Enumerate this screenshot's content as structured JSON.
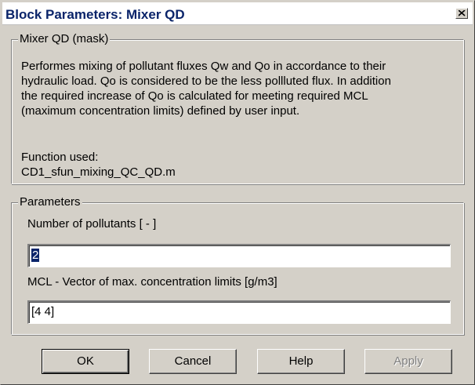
{
  "window": {
    "title": "Block Parameters: Mixer QD",
    "close_icon": "close-icon"
  },
  "mask_group": {
    "legend": "Mixer QD (mask)",
    "description_lines": [
      "Performes mixing of pollutant fluxes Qw  and Qo in accordance to their",
      "hydraulic load. Qo is considered to be the less pollluted flux. In addition",
      "the required increase of Qo is calculated for meeting required MCL",
      "(maximum concentration limits) defined by user input."
    ],
    "function_label": "Function used:",
    "function_name": "CD1_sfun_mixing_QC_QD.m"
  },
  "parameters_group": {
    "legend": "Parameters",
    "fields": [
      {
        "label": "Number of pollutants [ - ]",
        "value": "2"
      },
      {
        "label": "MCL - Vector of max. concentration limits [g/m3]",
        "value": "[4 4]"
      }
    ]
  },
  "buttons": {
    "ok": "OK",
    "cancel": "Cancel",
    "help": "Help",
    "apply": "Apply"
  },
  "colors": {
    "dialog_face": "#d4d0c8",
    "title_text": "#0a246a",
    "selection": "#0a246a"
  }
}
